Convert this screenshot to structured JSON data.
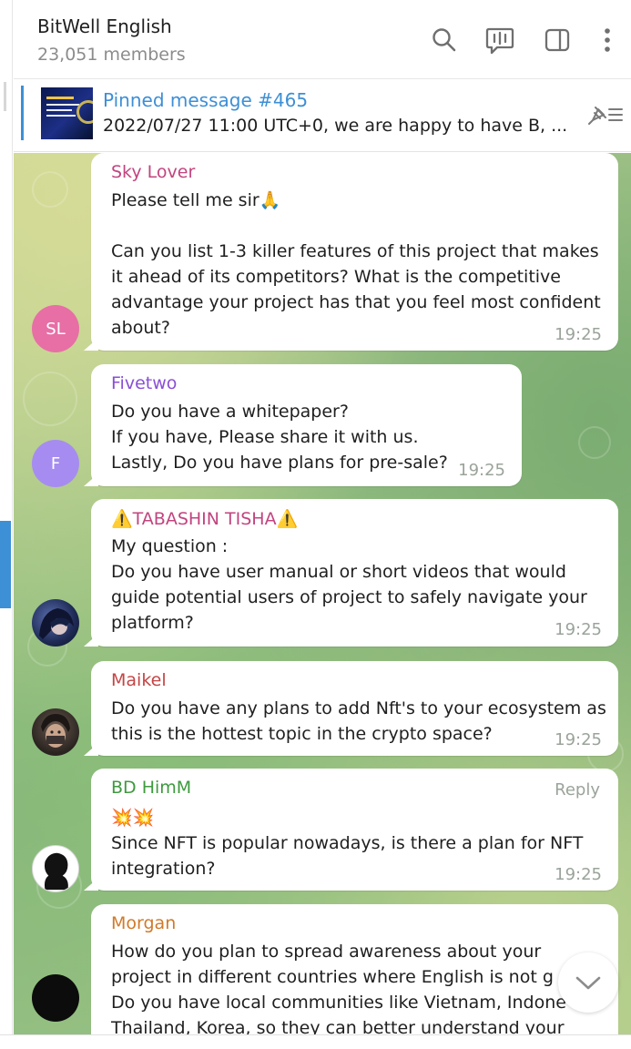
{
  "header": {
    "title": "BitWell English",
    "members": "23,051 members",
    "icons": [
      "search-icon",
      "live-chat-icon",
      "sidebar-toggle-icon",
      "more-vertical-icon"
    ]
  },
  "pinned": {
    "title": "Pinned message #465",
    "text": "2022/07/27 11:00 UTC+0, we are happy to have B, ...",
    "icon": "pin-list-icon"
  },
  "messages": [
    {
      "sender": "Sky Lover",
      "sender_color": "#c2447f",
      "avatar_initials": "SL",
      "avatar_color": "#e76fa5",
      "text_1": "Please tell me sir🙏",
      "text_2": "Can you list 1-3 killer features of this project that makes\nit ahead of its competitors? What is the competitive\nadvantage your project has that you feel most confident\nabout?",
      "time": "19:25"
    },
    {
      "sender": "Fivetwo",
      "sender_color": "#8a4fd4",
      "avatar_initials": "F",
      "avatar_color": "#a68cf0",
      "text": "Do you have a whitepaper?\nIf you have, Please share it with us.\nLastly, Do you have plans for pre-sale?",
      "time": "19:25"
    },
    {
      "sender": "⚠️TABASHIN TISHA⚠️",
      "sender_color": "#c2447f",
      "text": "My question :\nDo you have user manual or short videos that would\nguide potential users of project to safely navigate your\nplatform?",
      "time": "19:25"
    },
    {
      "sender": "Maikel",
      "sender_color": "#c44545",
      "text": "Do you have any plans to add Nft's to your ecosystem as\nthis is the hottest topic in the crypto space?",
      "time": "19:25"
    },
    {
      "sender": "BD HimM",
      "sender_color": "#3e9a3e",
      "reply_label": "Reply",
      "emoji_line": "💥💥",
      "text": "Since NFT is popular nowadays, is there a plan for NFT\nintegration?",
      "time": "19:25"
    },
    {
      "sender": "Morgan",
      "sender_color": "#d07a2a",
      "text": "How do you plan to spread awareness about your\nproject in different countries where English is not g\nDo you have local communities like Vietnam, Indone\nThailand, Korea, so they can better understand your"
    }
  ],
  "colors": {
    "accent": "#3d8fd6",
    "bubble": "#ffffff",
    "time": "#9aa39a"
  }
}
